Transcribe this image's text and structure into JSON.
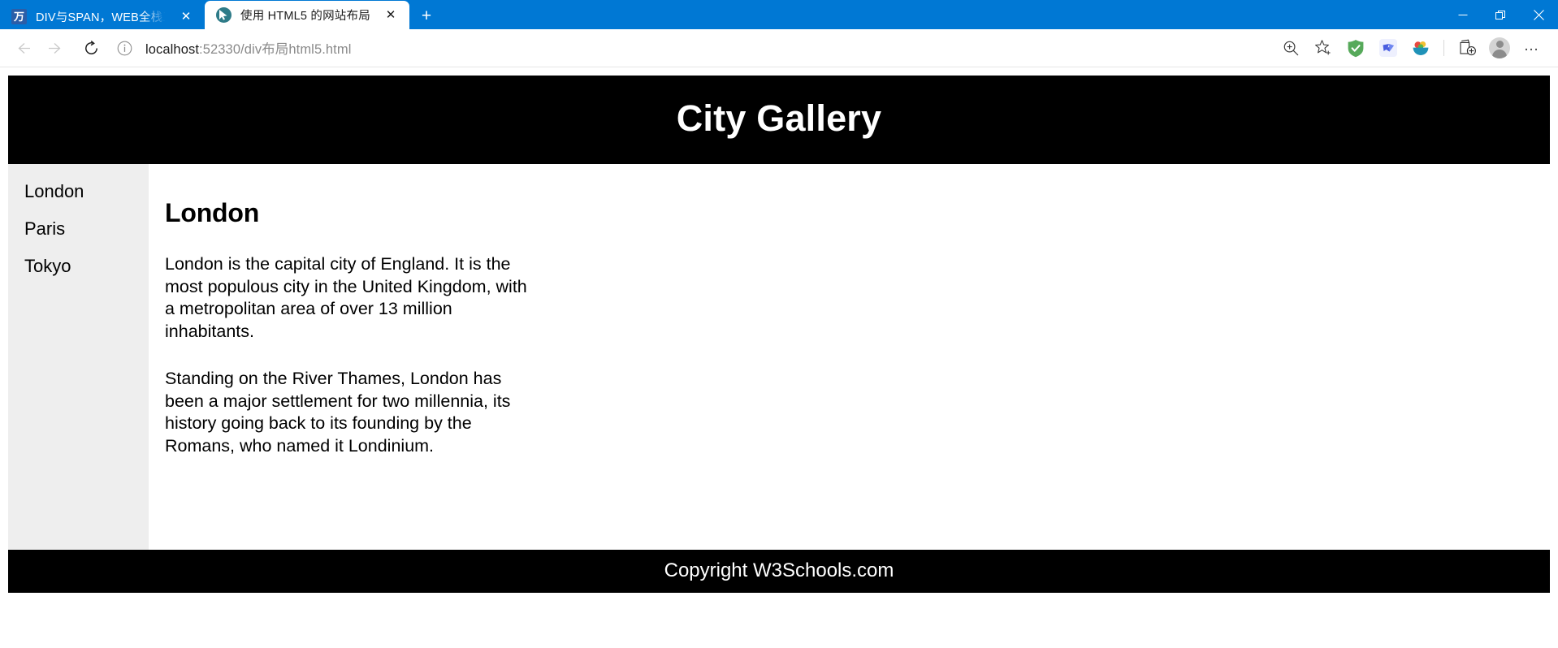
{
  "browser": {
    "tabs": [
      {
        "title": "DIV与SPAN，WEB全栈工程师零基",
        "favicon": "wanwei-icon",
        "favicon_glyph": "万",
        "close_glyph": "✕",
        "active": false
      },
      {
        "title": "使用 HTML5 的网站布局",
        "favicon": "live-server-cursor-icon",
        "close_glyph": "✕",
        "active": true
      }
    ],
    "new_tab_glyph": "+",
    "window_controls": {
      "minimize": "minimize-button",
      "restore": "restore-button",
      "close": "close-button"
    },
    "navigation": {
      "back": "back-button",
      "forward": "forward-button",
      "refresh": "refresh-button"
    },
    "address_bar": {
      "info_icon": "site-information-icon",
      "url_host": "localhost",
      "url_rest": ":52330/div布局html5.html",
      "url_full": "localhost:52330/div布局html5.html"
    },
    "toolbar_icons": [
      {
        "name": "zoom-in-icon"
      },
      {
        "name": "add-favorite-star-icon"
      },
      {
        "name": "adguard-extension-icon",
        "color": "#56a95a"
      },
      {
        "name": "bird-extension-icon",
        "color": "#4a5ee0"
      },
      {
        "name": "fruit-bowl-extension-icon",
        "color": "#1f92b8"
      },
      {
        "name": "collections-icon"
      },
      {
        "name": "profile-avatar"
      },
      {
        "name": "settings-and-more-icon",
        "glyph": "…"
      }
    ]
  },
  "page": {
    "header_title": "City Gallery",
    "nav_items": [
      "London",
      "Paris",
      "Tokyo"
    ],
    "article": {
      "heading": "London",
      "paragraphs": [
        "London is the capital city of England. It is the most populous city in the United Kingdom, with a metropolitan area of over 13 million inhabitants.",
        "Standing on the River Thames, London has been a major settlement for two millennia, its history going back to its founding by the Romans, who named it Londinium."
      ]
    },
    "footer_text": "Copyright W3Schools.com",
    "colors": {
      "header_bg": "#000000",
      "sidebar_bg": "#eeeeee",
      "content_bg": "#ffffff",
      "footer_bg": "#000000",
      "browser_accent": "#0078d4"
    }
  }
}
